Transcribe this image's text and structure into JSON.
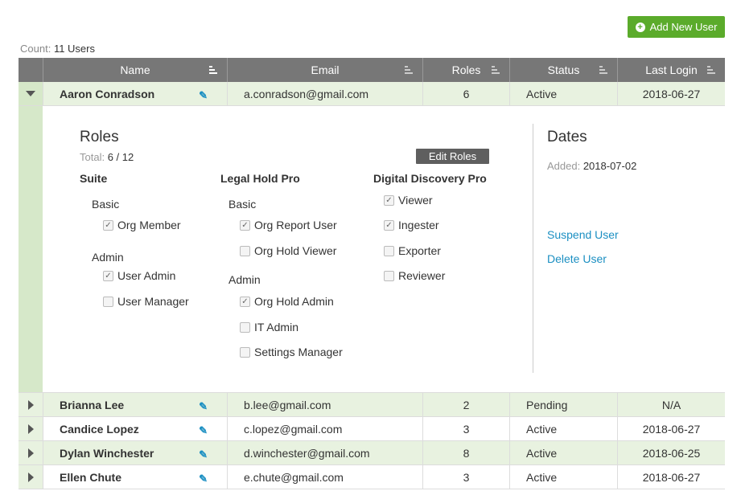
{
  "add_button_label": "Add New User",
  "count_label": "Count:",
  "count_value": "11 Users",
  "columns": [
    "Name",
    "Email",
    "Roles",
    "Status",
    "Last Login"
  ],
  "expanded_user": {
    "name": "Aaron Conradson",
    "email": "a.conradson@gmail.com",
    "roles": "6",
    "status": "Active",
    "last_login": "2018-06-27"
  },
  "detail": {
    "roles_title": "Roles",
    "total_label": "Total:",
    "total_value": "6 / 12",
    "edit_roles_label": "Edit Roles",
    "suite": {
      "title": "Suite",
      "basic_label": "Basic",
      "basic_items": [
        {
          "label": "Org Member",
          "checked": true
        }
      ],
      "admin_label": "Admin",
      "admin_items": [
        {
          "label": "User Admin",
          "checked": true
        },
        {
          "label": "User Manager",
          "checked": false
        }
      ]
    },
    "legal_hold_pro": {
      "title": "Legal Hold Pro",
      "basic_label": "Basic",
      "basic_items": [
        {
          "label": "Org Report User",
          "checked": true
        },
        {
          "label": "Org Hold Viewer",
          "checked": false
        }
      ],
      "admin_label": "Admin",
      "admin_items": [
        {
          "label": "Org Hold Admin",
          "checked": true
        },
        {
          "label": "IT Admin",
          "checked": false
        },
        {
          "label": "Settings Manager",
          "checked": false
        }
      ]
    },
    "digital_discovery_pro": {
      "title": "Digital Discovery Pro",
      "items": [
        {
          "label": "Viewer",
          "checked": true
        },
        {
          "label": "Ingester",
          "checked": true
        },
        {
          "label": "Exporter",
          "checked": false
        },
        {
          "label": "Reviewer",
          "checked": false
        }
      ]
    },
    "dates_title": "Dates",
    "added_label": "Added:",
    "added_value": "2018-07-02",
    "suspend_label": "Suspend User",
    "delete_label": "Delete User"
  },
  "rows": [
    {
      "name": "Brianna Lee",
      "email": "b.lee@gmail.com",
      "roles": "2",
      "status": "Pending",
      "last_login": "N/A"
    },
    {
      "name": "Candice Lopez",
      "email": "c.lopez@gmail.com",
      "roles": "3",
      "status": "Active",
      "last_login": "2018-06-27"
    },
    {
      "name": "Dylan Winchester",
      "email": "d.winchester@gmail.com",
      "roles": "8",
      "status": "Active",
      "last_login": "2018-06-25"
    },
    {
      "name": "Ellen Chute",
      "email": "e.chute@gmail.com",
      "roles": "3",
      "status": "Active",
      "last_login": "2018-06-27"
    }
  ],
  "colors": {
    "accent_green": "#5bab2b",
    "link_blue": "#1b8fc2",
    "header_gray": "#777777"
  }
}
